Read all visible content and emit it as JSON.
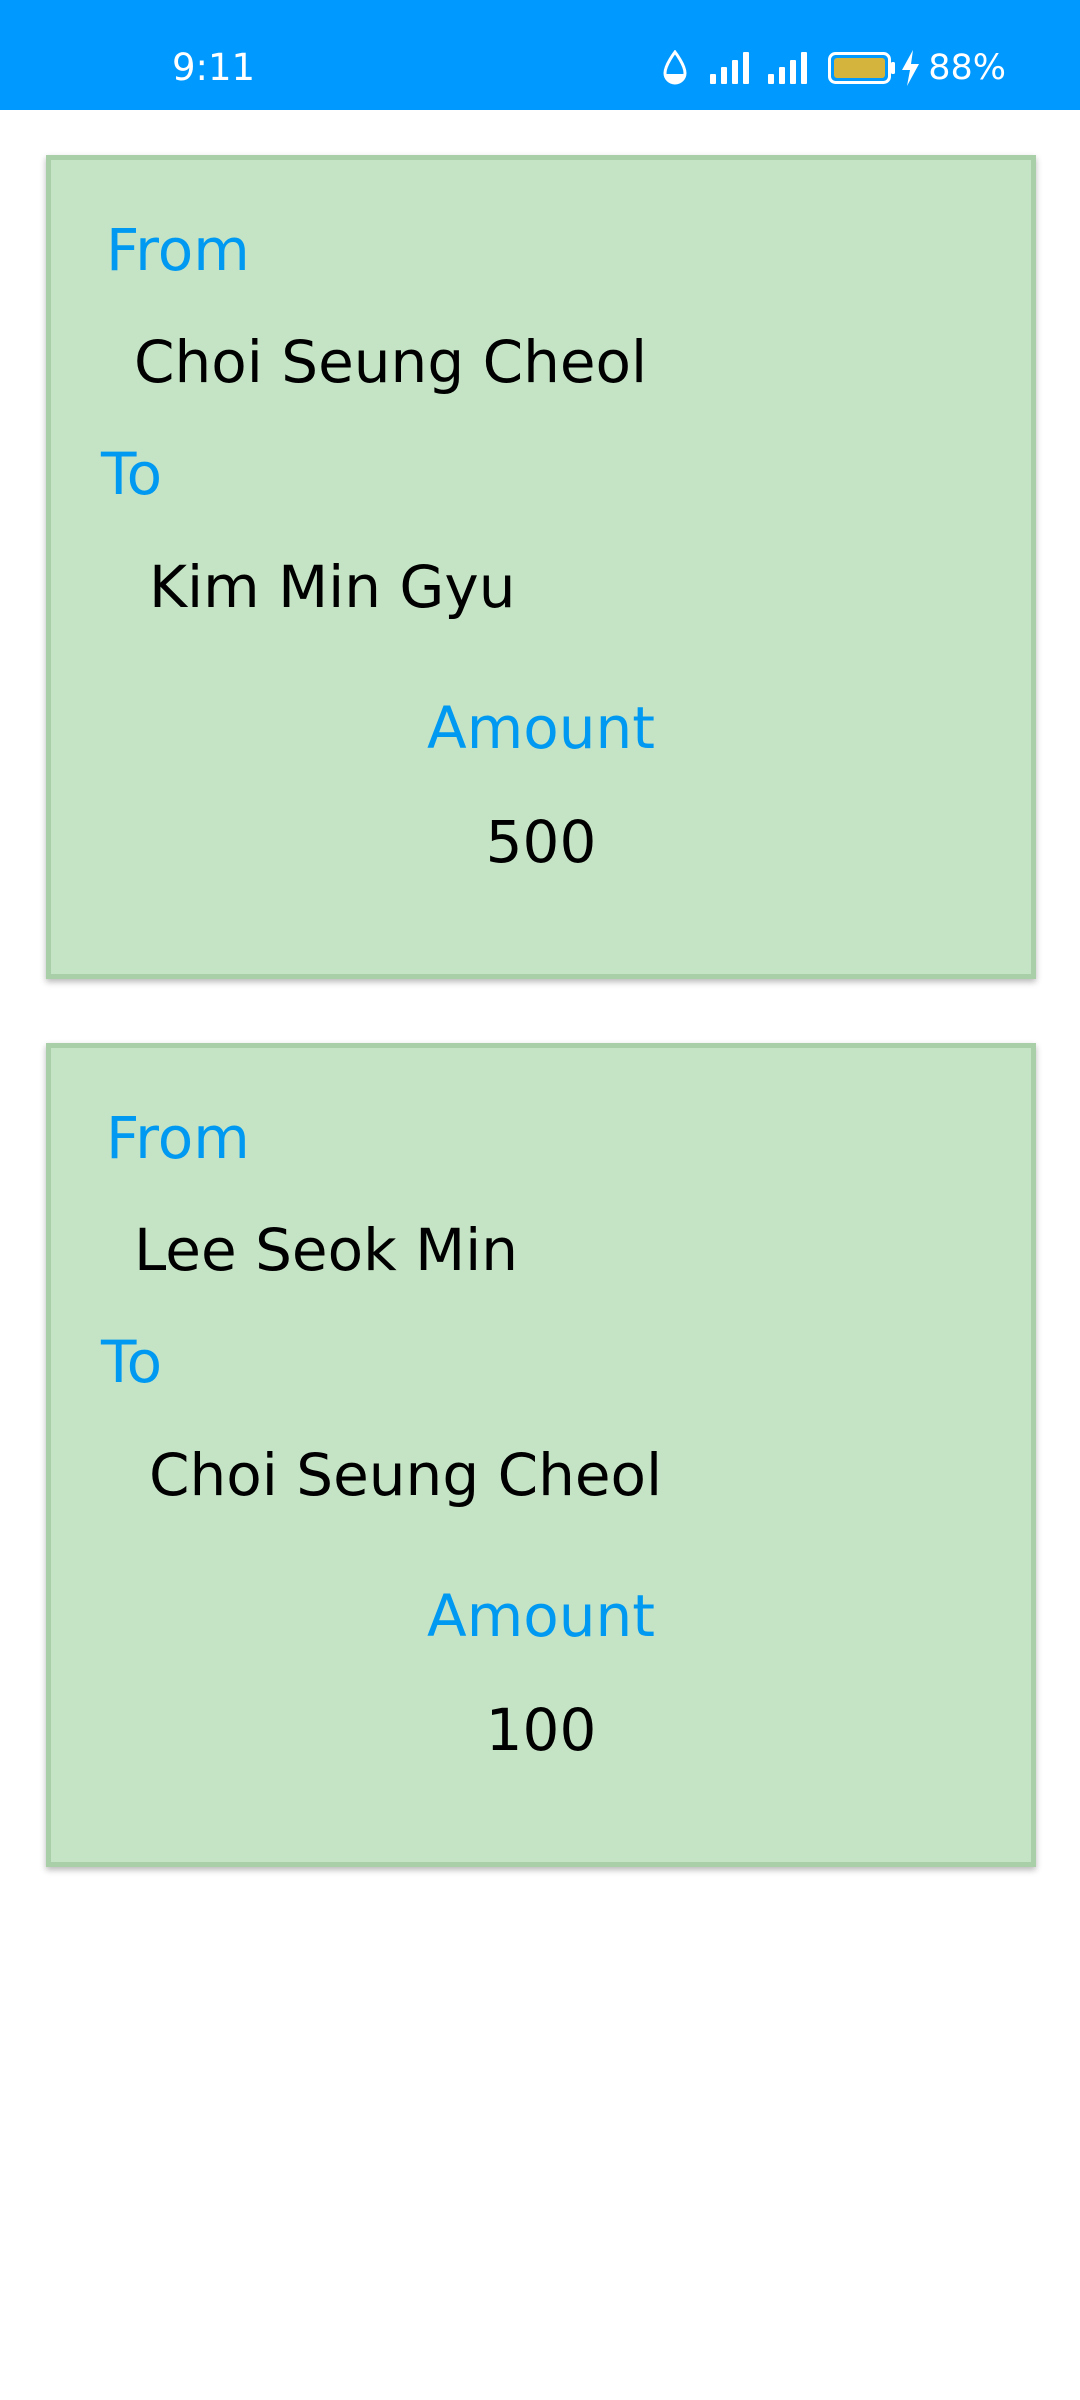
{
  "status_bar": {
    "time": "9:11",
    "battery_percent": "88%",
    "background_color": "#0099ff",
    "icons": [
      "water-drop-icon",
      "signal-strength-icon",
      "signal-strength-icon",
      "battery-icon",
      "charging-bolt-icon"
    ],
    "battery_fill_color": "#d4b43c"
  },
  "transactions": [
    {
      "from_label": "From",
      "from": "Choi Seung Cheol",
      "to_label": "To",
      "to": "Kim Min Gyu",
      "amount_label": "Amount",
      "amount": "500"
    },
    {
      "from_label": "From",
      "from": "Lee Seok Min",
      "to_label": "To",
      "to": "Choi Seung Cheol",
      "amount_label": "Amount",
      "amount": "100"
    }
  ],
  "colors": {
    "card_background": "#c5e4c5",
    "card_border": "#a9cfa9",
    "label_color": "#0099f2",
    "value_color": "#000000"
  }
}
